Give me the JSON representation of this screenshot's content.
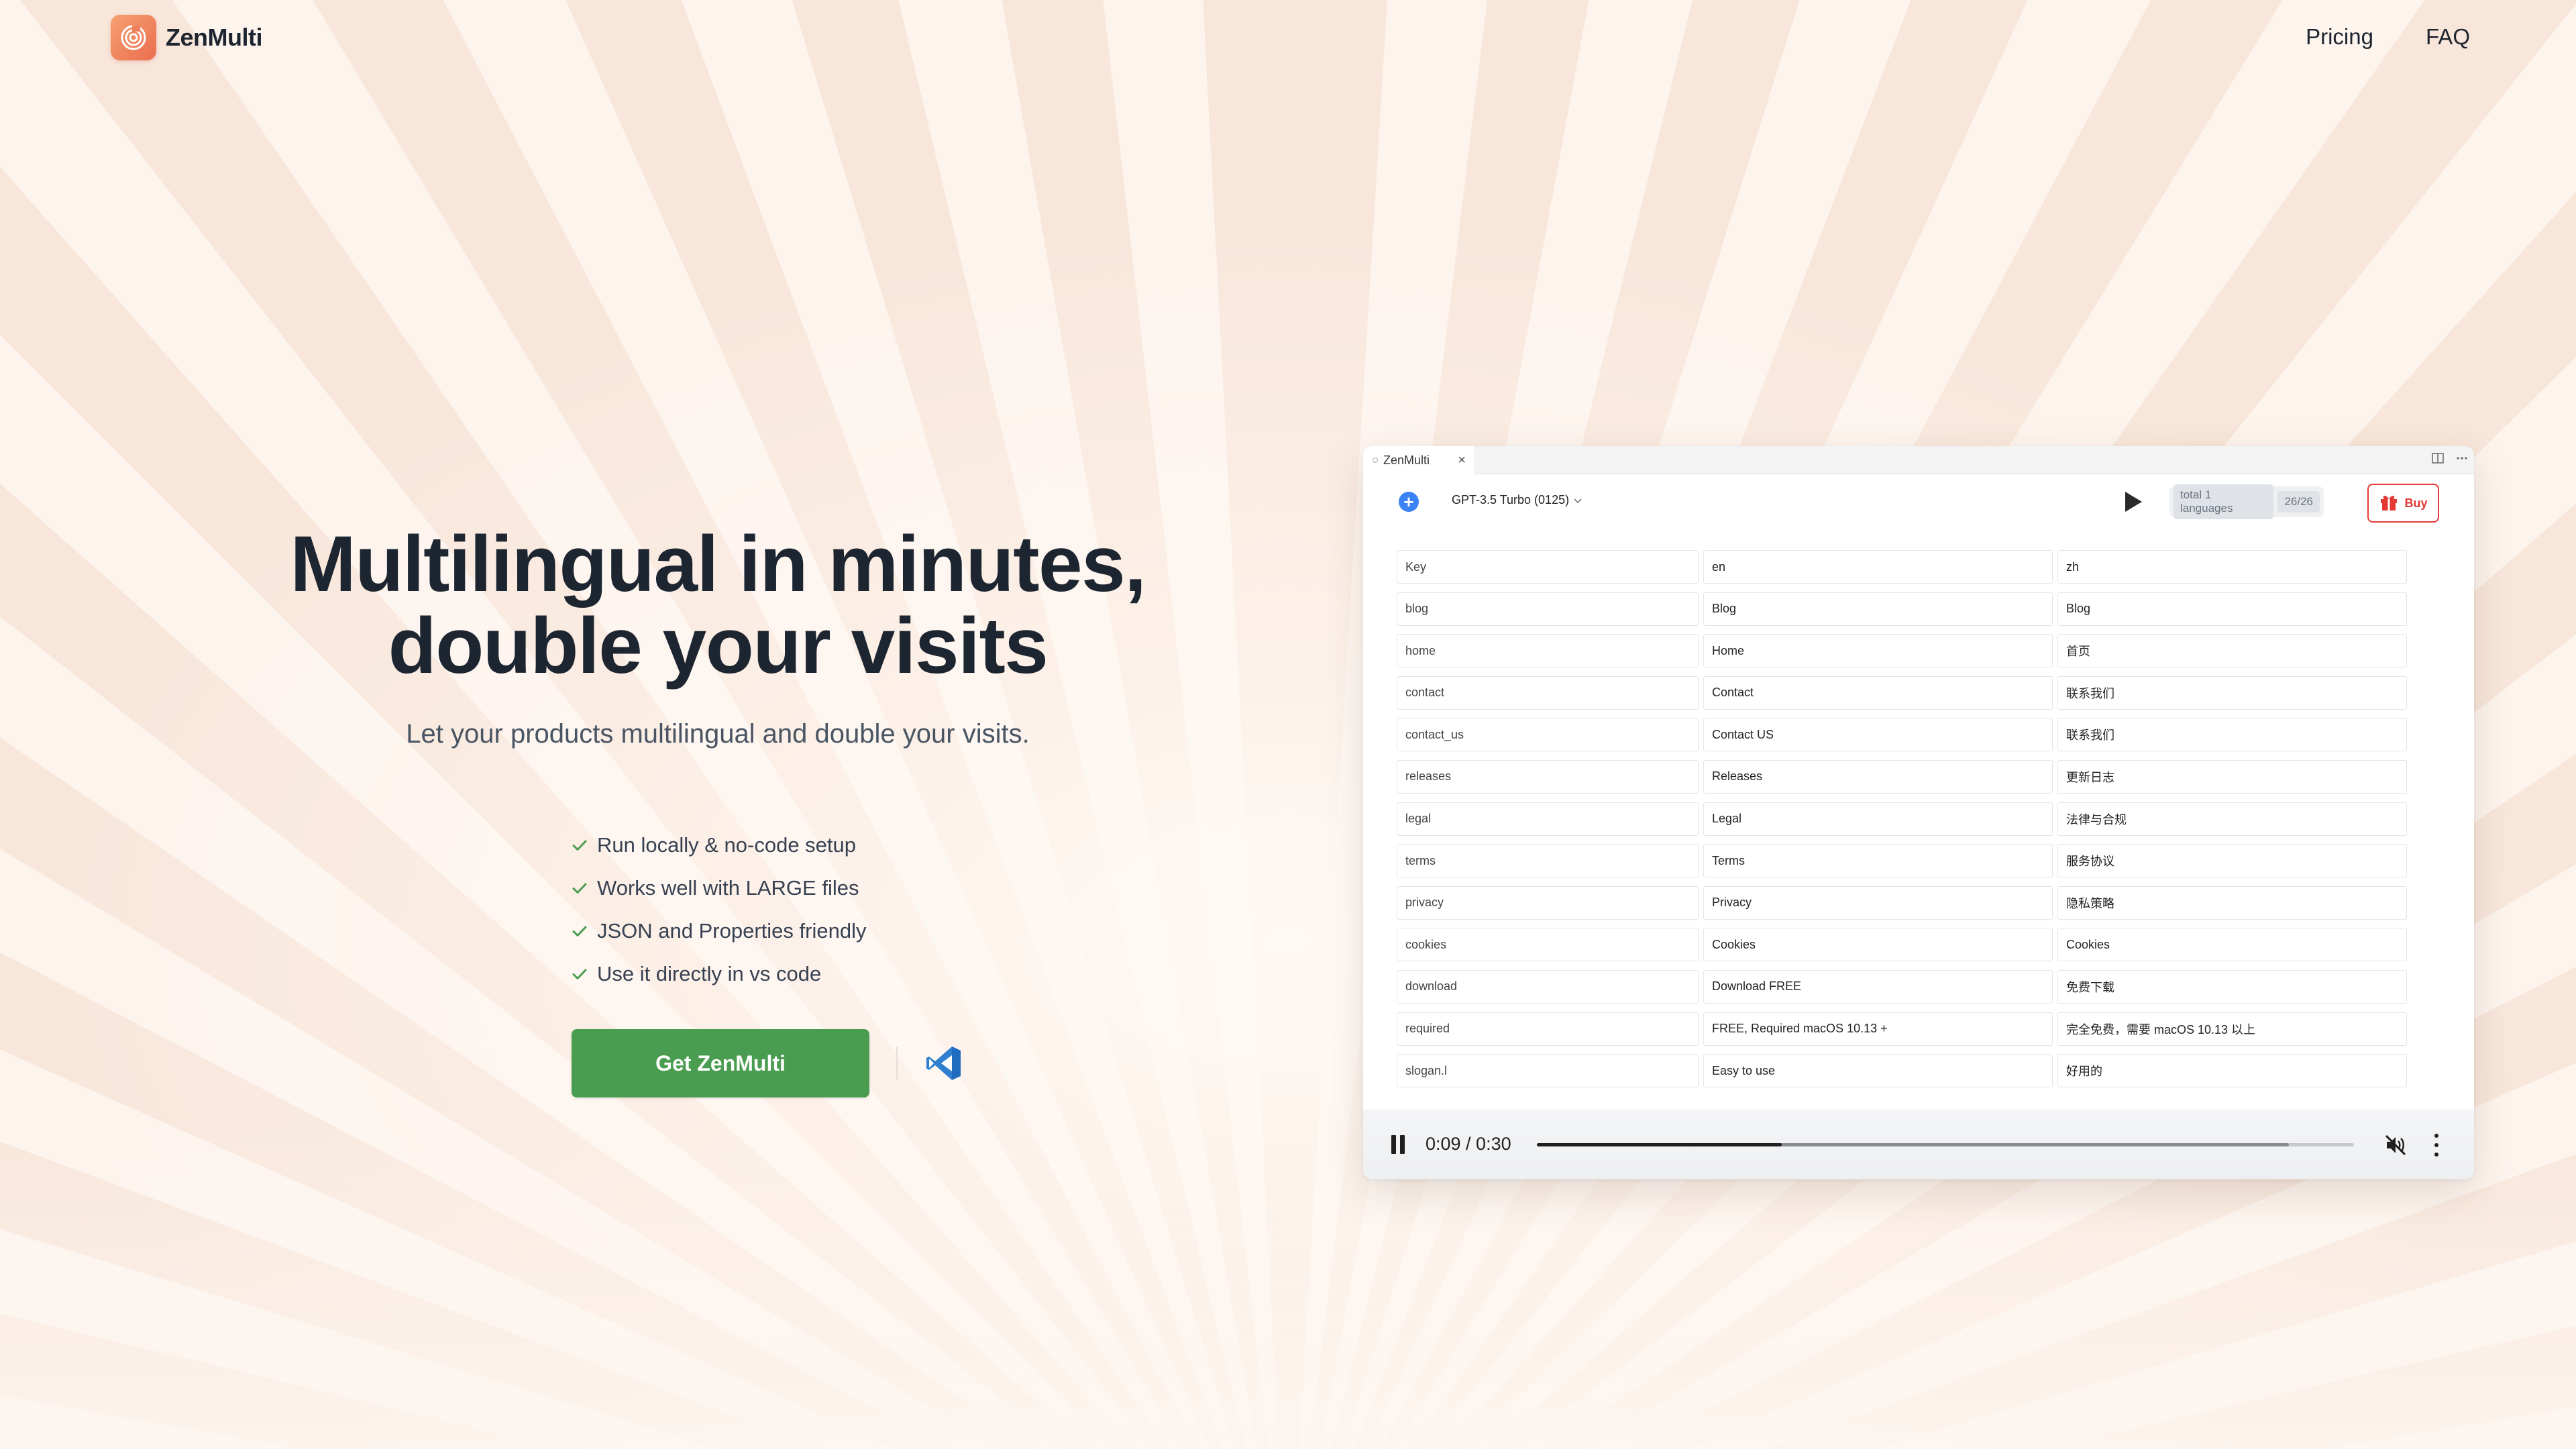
{
  "brand": {
    "name": "ZenMulti",
    "logo_icon": "spiral-logo-icon",
    "accent": "#ea6d4f"
  },
  "nav": {
    "items": [
      "Pricing",
      "FAQ"
    ]
  },
  "hero": {
    "title_line1": "Multilingual in minutes,",
    "title_line2": "double your visits",
    "subtitle": "Let your products multilingual and double your visits."
  },
  "features": [
    "Run locally & no-code setup",
    "Works well with LARGE files",
    "JSON and Properties friendly",
    "Use it directly in vs code"
  ],
  "cta": {
    "label": "Get ZenMulti",
    "color": "#4a9d50",
    "secondary_icon": "vscode-icon"
  },
  "app": {
    "tab_title": "ZenMulti",
    "tab_close": "×",
    "model": "GPT-3.5 Turbo (0125)",
    "languages_label": "total 1 languages",
    "count": "26/26",
    "buy_label": "Buy",
    "table": {
      "columns": [
        "Key",
        "en",
        "zh"
      ],
      "rows": [
        [
          "blog",
          "Blog",
          "Blog"
        ],
        [
          "home",
          "Home",
          "首页"
        ],
        [
          "contact",
          "Contact",
          "联系我们"
        ],
        [
          "contact_us",
          "Contact US",
          "联系我们"
        ],
        [
          "releases",
          "Releases",
          "更新日志"
        ],
        [
          "legal",
          "Legal",
          "法律与合规"
        ],
        [
          "terms",
          "Terms",
          "服务协议"
        ],
        [
          "privacy",
          "Privacy",
          "隐私策略"
        ],
        [
          "cookies",
          "Cookies",
          "Cookies"
        ],
        [
          "download",
          "Download FREE",
          "免费下载"
        ],
        [
          "required",
          "FREE, Required macOS 10.13 +",
          "完全免费，需要 macOS 10.13 以上"
        ],
        [
          "slogan.l",
          "Easy to use",
          "好用的"
        ]
      ]
    }
  },
  "video": {
    "time": "0:09 / 0:30",
    "played_fraction": 0.3,
    "buffered_fraction": 0.92,
    "muted": true
  }
}
